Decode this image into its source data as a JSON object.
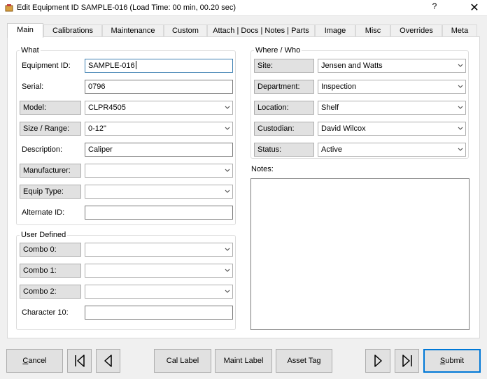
{
  "window": {
    "title": "Edit Equipment ID SAMPLE-016 (Load Time: 00 min, 00.20 sec)",
    "help_label": "?",
    "close_label": "✕"
  },
  "tabs": [
    {
      "label": "Main",
      "active": true
    },
    {
      "label": "Calibrations"
    },
    {
      "label": "Maintenance"
    },
    {
      "label": "Custom"
    },
    {
      "label": "Attach | Docs | Notes | Parts"
    },
    {
      "label": "Image"
    },
    {
      "label": "Misc"
    },
    {
      "label": "Overrides"
    },
    {
      "label": "Meta"
    }
  ],
  "what": {
    "legend": "What",
    "equipment_id": {
      "label": "Equipment ID:",
      "value": "SAMPLE-016"
    },
    "serial": {
      "label": "Serial:",
      "value": "0796"
    },
    "model": {
      "label": "Model:",
      "value": "CLPR4505"
    },
    "size_range": {
      "label": "Size / Range:",
      "value": "0-12\""
    },
    "description": {
      "label": "Description:",
      "value": "Caliper"
    },
    "manufacturer": {
      "label": "Manufacturer:",
      "value": ""
    },
    "equip_type": {
      "label": "Equip Type:",
      "value": ""
    },
    "alternate_id": {
      "label": "Alternate ID:",
      "value": ""
    }
  },
  "user_defined": {
    "legend": "User Defined",
    "combo0": {
      "label": "Combo 0:",
      "value": ""
    },
    "combo1": {
      "label": "Combo 1:",
      "value": ""
    },
    "combo2": {
      "label": "Combo 2:",
      "value": ""
    },
    "character10": {
      "label": "Character 10:",
      "value": ""
    }
  },
  "where_who": {
    "legend": "Where / Who",
    "site": {
      "label": "Site:",
      "value": "Jensen and Watts"
    },
    "department": {
      "label": "Department:",
      "value": "Inspection"
    },
    "location": {
      "label": "Location:",
      "value": "Shelf"
    },
    "custodian": {
      "label": "Custodian:",
      "value": "David Wilcox"
    },
    "status": {
      "label": "Status:",
      "value": "Active"
    }
  },
  "notes": {
    "label": "Notes:",
    "value": ""
  },
  "buttons": {
    "cancel_first": "C",
    "cancel_rest": "ancel",
    "cal_label": "Cal Label",
    "maint_label": "Maint Label",
    "asset_tag": "Asset Tag",
    "submit_first": "S",
    "submit_rest": "ubmit"
  },
  "icons": {
    "first": "skip-first-icon",
    "prev": "previous-icon",
    "next": "next-icon",
    "last": "skip-last-icon",
    "dropdown": "chevron-down-icon"
  }
}
